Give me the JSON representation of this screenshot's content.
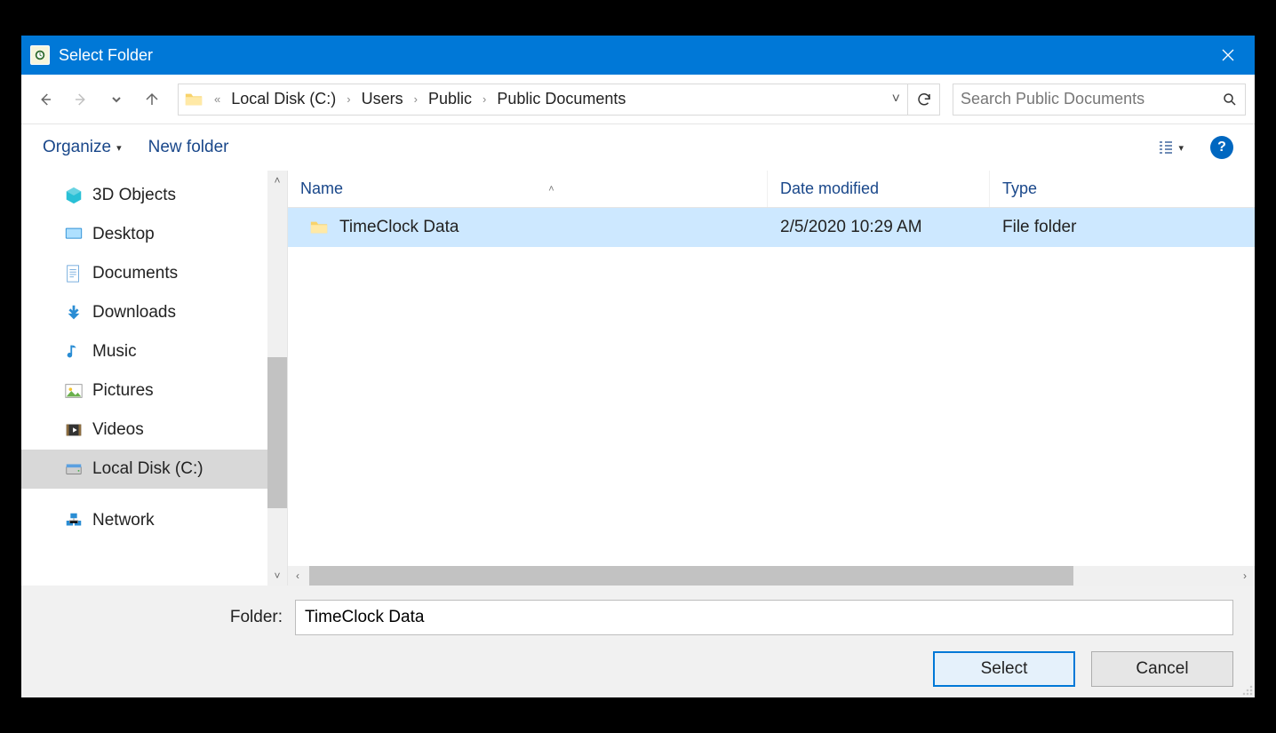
{
  "window": {
    "title": "Select Folder"
  },
  "breadcrumb": {
    "prefix": "«",
    "items": [
      "Local Disk (C:)",
      "Users",
      "Public",
      "Public Documents"
    ]
  },
  "search": {
    "placeholder": "Search Public Documents"
  },
  "toolbar": {
    "organize": "Organize",
    "new_folder": "New folder"
  },
  "tree": {
    "items": [
      {
        "label": "3D Objects",
        "icon": "cube",
        "color": "#29c0d6"
      },
      {
        "label": "Desktop",
        "icon": "desktop",
        "color": "#2a8dd4"
      },
      {
        "label": "Documents",
        "icon": "doc",
        "color": "#6fa8dc"
      },
      {
        "label": "Downloads",
        "icon": "download",
        "color": "#2a8dd4"
      },
      {
        "label": "Music",
        "icon": "music",
        "color": "#2a8dd4"
      },
      {
        "label": "Pictures",
        "icon": "picture",
        "color": "#4aa3df"
      },
      {
        "label": "Videos",
        "icon": "video",
        "color": "#4aa3df"
      },
      {
        "label": "Local Disk (C:)",
        "icon": "disk",
        "color": "#8a8a8a",
        "selected": true
      },
      {
        "label": "Network",
        "icon": "network",
        "color": "#2a8dd4",
        "group": true
      }
    ]
  },
  "columns": {
    "name": "Name",
    "date": "Date modified",
    "type": "Type"
  },
  "rows": [
    {
      "name": "TimeClock Data",
      "date": "2/5/2020 10:29 AM",
      "type": "File folder",
      "selected": true
    }
  ],
  "footer": {
    "folder_label": "Folder:",
    "folder_value": "TimeClock Data",
    "select": "Select",
    "cancel": "Cancel"
  }
}
